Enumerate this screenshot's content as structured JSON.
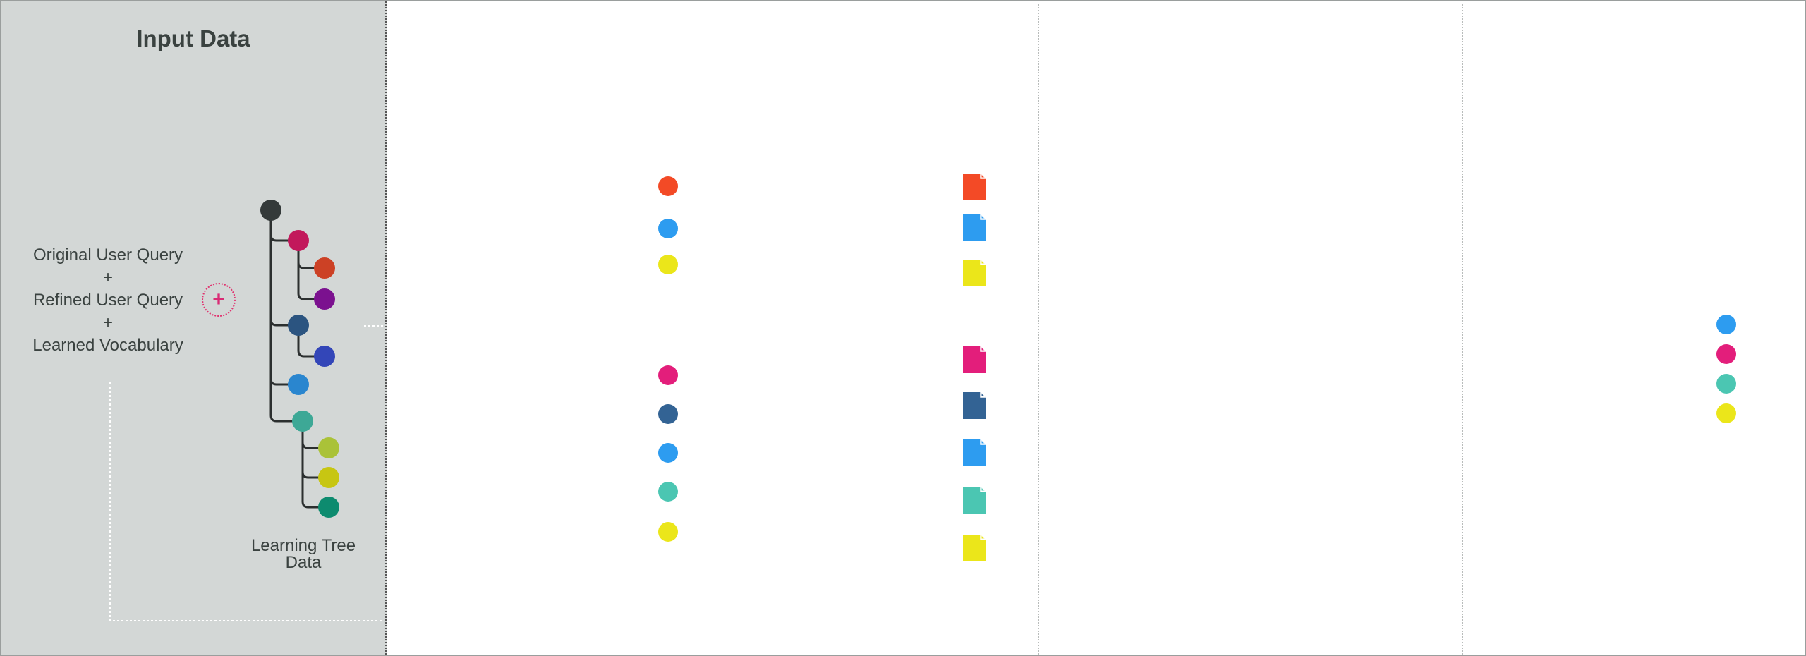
{
  "input_panel": {
    "title": "Input Data",
    "query_lines": [
      "Original User Query",
      "+",
      "Refined User Query",
      "+",
      "Learned Vocabulary"
    ],
    "combine_icon": "plus-icon",
    "tree_label_lines": [
      "Learning Tree",
      "Data"
    ],
    "tree_nodes": [
      {
        "id": "root",
        "color": "#343a3a",
        "parent": null
      },
      {
        "id": "n1",
        "color": "#c2185b",
        "parent": "root"
      },
      {
        "id": "n1a",
        "color": "#cc4125",
        "parent": "n1"
      },
      {
        "id": "n1b",
        "color": "#7b118f",
        "parent": "n1"
      },
      {
        "id": "n2",
        "color": "#2b5480",
        "parent": "root"
      },
      {
        "id": "n2a",
        "color": "#3346b8",
        "parent": "n2"
      },
      {
        "id": "n3",
        "color": "#2a86cf",
        "parent": "root"
      },
      {
        "id": "n4",
        "color": "#3da896",
        "parent": "root"
      },
      {
        "id": "n4a",
        "color": "#aac238",
        "parent": "n4"
      },
      {
        "id": "n4b",
        "color": "#c7c612",
        "parent": "n4"
      },
      {
        "id": "n4c",
        "color": "#0d8b6f",
        "parent": "n4"
      }
    ]
  },
  "stage2": {
    "group1": {
      "circles": [
        "#f34a26",
        "#2d9cf0",
        "#ebe61a"
      ],
      "documents": [
        "#f34a26",
        "#2d9cf0",
        "#ebe61a"
      ]
    },
    "group2": {
      "circles": [
        "#e31e7b",
        "#336394",
        "#2d9cf0",
        "#4bc6b2",
        "#ebe61a"
      ],
      "documents": [
        "#e31e7b",
        "#336394",
        "#2d9cf0",
        "#4bc6b2",
        "#ebe61a"
      ]
    }
  },
  "stage4": {
    "circles": [
      "#2d9cf0",
      "#e31e7b",
      "#4bc6b2",
      "#ebe61a"
    ]
  }
}
